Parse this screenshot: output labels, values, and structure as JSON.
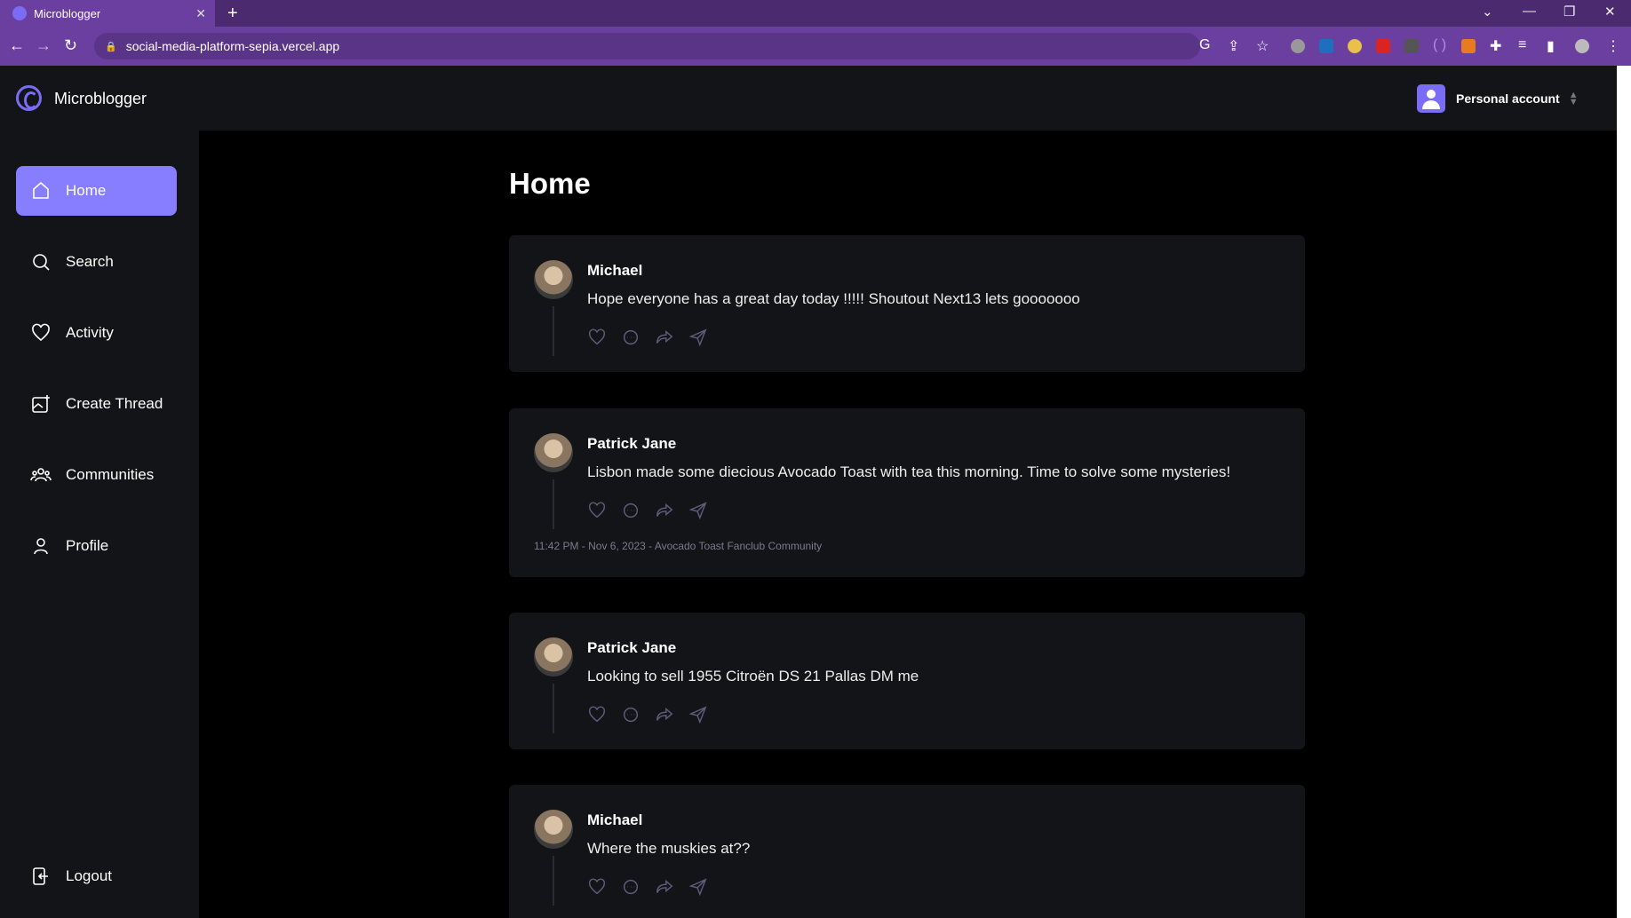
{
  "browser": {
    "tab_title": "Microblogger",
    "url": "social-media-platform-sepia.vercel.app",
    "accent": "#6b3fa0"
  },
  "header": {
    "app_name": "Microblogger",
    "account_label": "Personal account",
    "brand_color": "#877eff"
  },
  "sidebar": {
    "items": [
      {
        "label": "Home",
        "icon": "home-icon",
        "active": true
      },
      {
        "label": "Search",
        "icon": "search-icon",
        "active": false
      },
      {
        "label": "Activity",
        "icon": "heart-icon",
        "active": false
      },
      {
        "label": "Create Thread",
        "icon": "create-thread-icon",
        "active": false
      },
      {
        "label": "Communities",
        "icon": "communities-icon",
        "active": false
      },
      {
        "label": "Profile",
        "icon": "user-icon",
        "active": false
      }
    ],
    "logout_label": "Logout"
  },
  "main": {
    "title": "Home",
    "posts": [
      {
        "author": "Michael",
        "text": "Hope everyone has a great day today !!!!! Shoutout Next13 lets gooooooo",
        "meta": ""
      },
      {
        "author": "Patrick Jane",
        "text": "Lisbon made some diecious Avocado Toast with tea this morning. Time to solve some mysteries!",
        "meta": "11:42 PM - Nov 6, 2023 - Avocado Toast Fanclub Community"
      },
      {
        "author": "Patrick Jane",
        "text": "Looking to sell 1955 Citroën DS 21 Pallas DM me",
        "meta": ""
      },
      {
        "author": "Michael",
        "text": "Where the muskies at??",
        "meta": ""
      }
    ]
  }
}
